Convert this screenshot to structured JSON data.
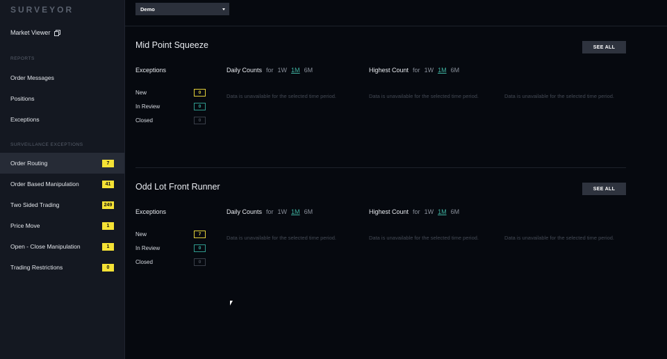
{
  "app": {
    "brand": "SURVEYOR"
  },
  "sidebar": {
    "market_viewer": "Market Viewer",
    "market_viewer_icon": "external-window-icon",
    "reports_label": "REPORTS",
    "reports": [
      {
        "label": "Order Messages"
      },
      {
        "label": "Positions"
      },
      {
        "label": "Exceptions"
      }
    ],
    "surveillance_label": "SURVEILLANCE EXCEPTIONS",
    "surveillance": [
      {
        "label": "Order Routing",
        "count": "7",
        "active": true
      },
      {
        "label": "Order Based Manipulation",
        "count": "41"
      },
      {
        "label": "Two Sided Trading",
        "count": "249"
      },
      {
        "label": "Price Move",
        "count": "1"
      },
      {
        "label": "Open - Close Manipulation",
        "count": "1"
      },
      {
        "label": "Trading Restrictions",
        "count": "0"
      }
    ]
  },
  "header": {
    "dataset": "Demo"
  },
  "panels": [
    {
      "title": "Mid Point Squeeze",
      "see_all": "SEE ALL",
      "exceptions_label": "Exceptions",
      "stats": [
        {
          "label": "New",
          "value": "0"
        },
        {
          "label": "In Review",
          "value": "0"
        },
        {
          "label": "Closed",
          "value": "0"
        }
      ],
      "daily": {
        "name": "Daily Counts",
        "for": "for",
        "ranges": [
          "1W",
          "1M",
          "6M"
        ],
        "selected": "1M"
      },
      "highest": {
        "name": "Highest Count",
        "for": "for",
        "ranges": [
          "1W",
          "1M",
          "6M"
        ],
        "selected": "1M"
      },
      "unavailable": [
        "Data is unavailable for the selected time period.",
        "Data is unavailable for the selected time period.",
        "Data is unavailable for the selected time period."
      ]
    },
    {
      "title": "Odd Lot Front Runner",
      "see_all": "SEE ALL",
      "exceptions_label": "Exceptions",
      "stats": [
        {
          "label": "New",
          "value": "7"
        },
        {
          "label": "In Review",
          "value": "0"
        },
        {
          "label": "Closed",
          "value": "0"
        }
      ],
      "daily": {
        "name": "Daily Counts",
        "for": "for",
        "ranges": [
          "1W",
          "1M",
          "6M"
        ],
        "selected": "1M"
      },
      "highest": {
        "name": "Highest Count",
        "for": "for",
        "ranges": [
          "1W",
          "1M",
          "6M"
        ],
        "selected": "1M"
      },
      "unavailable": [
        "Data is unavailable for the selected time period.",
        "Data is unavailable for the selected time period.",
        "Data is unavailable for the selected time period."
      ]
    }
  ],
  "colors": {
    "badge": "#f5e235",
    "selected_range": "#3fb3a1",
    "background": "#06090f",
    "sidebar": "#141821"
  }
}
